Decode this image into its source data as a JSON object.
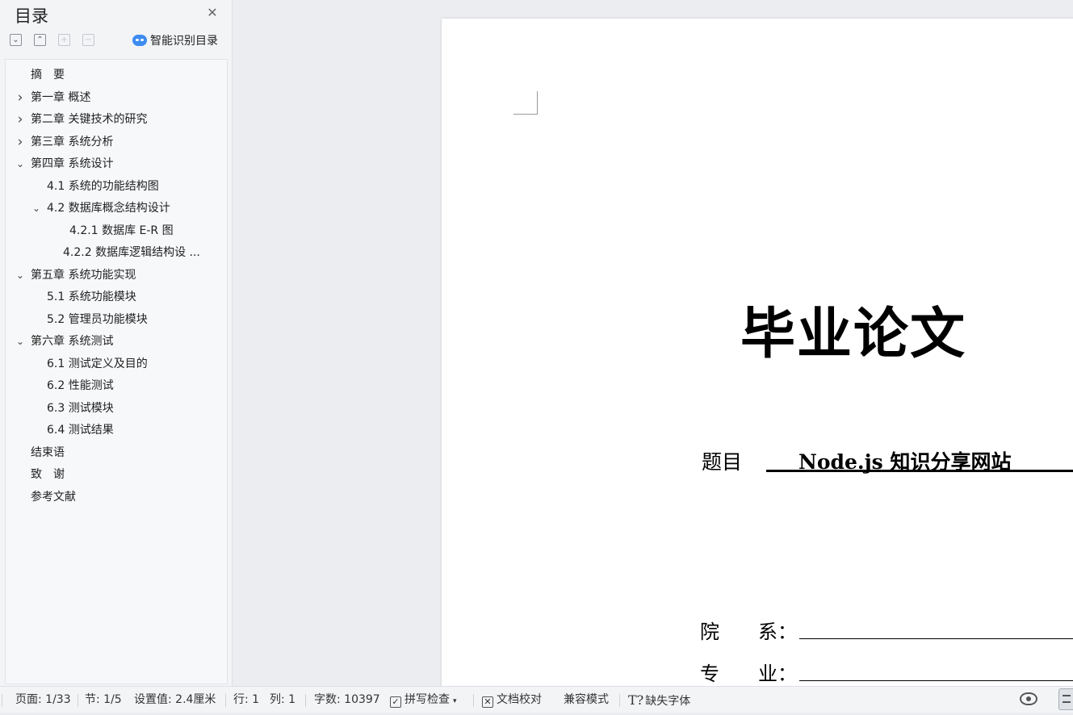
{
  "sidebar": {
    "title": "目录",
    "close_icon": "close-icon",
    "tools": {
      "expand_icon": "chevron-down-icon",
      "collapse_icon": "chevron-up-icon",
      "add_icon": "plus-icon",
      "remove_icon": "minus-icon"
    },
    "smart_label": "智能识别目录",
    "toc": [
      {
        "label": "摘　要",
        "level": 0,
        "chevron": ""
      },
      {
        "label": "第一章  概述",
        "level": 0,
        "chevron": "right"
      },
      {
        "label": " 第二章   关键技术的研究",
        "level": 0,
        "chevron": "right"
      },
      {
        "label": "第三章  系统分析",
        "level": 0,
        "chevron": "right"
      },
      {
        "label": "第四章  系统设计",
        "level": 0,
        "chevron": "down"
      },
      {
        "label": "4.1  系统的功能结构图",
        "level": 1,
        "chevron": ""
      },
      {
        "label": "4.2  数据库概念结构设计",
        "level": 1,
        "chevron": "down"
      },
      {
        "label": "4.2.1    数据库 E-R 图",
        "level": 2,
        "chevron": ""
      },
      {
        "label": "4.2.2  数据库逻辑结构设 ...",
        "level": 2,
        "chevron": ""
      },
      {
        "label": "第五章  系统功能实现",
        "level": 0,
        "chevron": "down"
      },
      {
        "label": "5.1 系统功能模块",
        "level": 1,
        "chevron": ""
      },
      {
        "label": "5.2 管理员功能模块",
        "level": 1,
        "chevron": ""
      },
      {
        "label": "第六章  系统测试",
        "level": 0,
        "chevron": "down"
      },
      {
        "label": "6.1 测试定义及目的",
        "level": 1,
        "chevron": ""
      },
      {
        "label": "6.2 性能测试",
        "level": 1,
        "chevron": ""
      },
      {
        "label": "6.3 测试模块",
        "level": 1,
        "chevron": ""
      },
      {
        "label": "6.4 测试结果",
        "level": 1,
        "chevron": ""
      },
      {
        "label": "结束语",
        "level": 0,
        "chevron": ""
      },
      {
        "label": "致　谢",
        "level": 0,
        "chevron": ""
      },
      {
        "label": "参考文献",
        "level": 0,
        "chevron": ""
      }
    ]
  },
  "document": {
    "title": "毕业论文",
    "subject_label": "题目",
    "subject_value": "Node.js 知识分享网站",
    "department_label": "院　　系：",
    "major_label": "专　　业："
  },
  "statusbar": {
    "page": "页面: 1/33",
    "section": "节: 1/5",
    "setting": "设置值: 2.4厘米",
    "row": "行: 1",
    "col": "列: 1",
    "word_count": "字数: 10397",
    "spell_check": "拼写检查",
    "doc_proof": "文档校对",
    "compat_mode": "兼容模式",
    "missing_font": "缺失字体",
    "eye_icon": "eye-icon",
    "view_icon": "page-view-icon"
  }
}
